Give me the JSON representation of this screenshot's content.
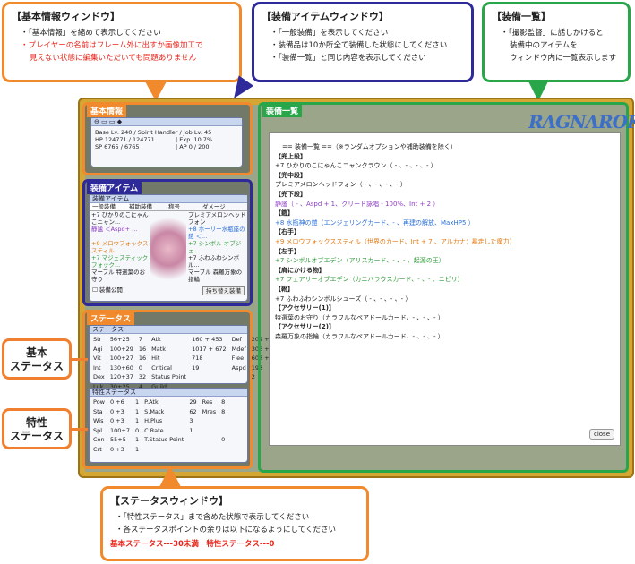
{
  "callouts": {
    "basic": {
      "title": "【基本情報ウィンドウ】",
      "lines": [
        "・「基本情報」を縮めて表示してください",
        "・プレイヤーの名前はフレーム外に出すか画像加工で",
        "見えない状態に編集いただいても問題ありません"
      ]
    },
    "equip": {
      "title": "【装備アイテムウィンドウ】",
      "lines": [
        "・「一般装備」を表示してください",
        "・装備品は10か所全て装備した状態にしてください",
        "・「装備一覧」と同じ内容を表示してください"
      ]
    },
    "list": {
      "title": "【装備一覧】",
      "lines": [
        "・「撮影監督」に話しかけると",
        "装備中のアイテムを",
        "ウィンドウ内に一覧表示します"
      ]
    },
    "status": {
      "title": "【ステータスウィンドウ】",
      "lines": [
        "・「特性ステータス」まで含めた状態で表示してください",
        "・各ステータスポイントの余りは以下になるようにしてください"
      ],
      "note": "基本ステータス---30未満　特性ステータス---0"
    }
  },
  "side_labels": {
    "basic_status": [
      "基本",
      "ステータス"
    ],
    "trait_status": [
      "特性",
      "ステータス"
    ]
  },
  "panels": {
    "basic": "基本情報",
    "equip": "装備アイテム",
    "status": "ステータス",
    "list": "装備一覧"
  },
  "basic_info": {
    "line1": "Base Lv. 240 / Spirit Handler / Job Lv. 45",
    "hp": "HP 124771 / 124771",
    "exp": "| Exp. 10.7%",
    "sp": "SP 6765 / 6765",
    "ap": "| AP 0 / 200"
  },
  "equip_win": {
    "title": "装備アイテム",
    "tabs": [
      "一般装備",
      "補助装備",
      "称号",
      "ダメージ"
    ],
    "left": [
      "+7 ひかりのこにゃんこニャン...",
      "静謐 ＜Aspd+ ...",
      "+9 メロウフォックススティル",
      "+7 マジェスティックフォック...",
      "マーブル 特選葉のお守り"
    ],
    "right": [
      "プレミアメロンヘッドフォン",
      "+8 ホーリー水瓶座の鎧 ＜...",
      "+7 シンボル オブジェ...",
      "+7 ふわふわシンボル...",
      "マーブル 森羅万象の指輪"
    ],
    "public": "装備公開",
    "swap": "持ち替え装備"
  },
  "status_win": {
    "title": "ステータス",
    "rows": [
      [
        "Str",
        "56+25",
        "7",
        "Atk",
        "160 + 453",
        "Def",
        "209 + 223"
      ],
      [
        "Agi",
        "100+29",
        "16",
        "Matk",
        "1017 + 672",
        "Mdef",
        "306 + 50"
      ],
      [
        "Vit",
        "100+27",
        "16",
        "Hit",
        "718",
        "Flee",
        "608 + 7"
      ],
      [
        "Int",
        "130+60",
        "0",
        "Critical",
        "19",
        "Aspd",
        "193"
      ],
      [
        "Dex",
        "120+37",
        "32",
        "Status Point",
        "",
        "",
        "2"
      ],
      [
        "Luk",
        "30+25",
        "4",
        "Guild",
        "",
        "",
        ""
      ]
    ],
    "trait_title": "特性ステータス",
    "trait_rows": [
      [
        "Pow",
        "0 +6",
        "1",
        "P.Atk",
        "29",
        "Res",
        "8"
      ],
      [
        "Sta",
        "0 +3",
        "1",
        "S.Matk",
        "62",
        "Mres",
        "8"
      ],
      [
        "Wis",
        "0 +3",
        "1",
        "H.Plus",
        "3",
        "",
        ""
      ],
      [
        "Spl",
        "100+7",
        "0",
        "C.Rate",
        "1",
        "",
        ""
      ],
      [
        "Con",
        "55+5",
        "1",
        "T.Status Point",
        "",
        "",
        "0"
      ],
      [
        "Crt",
        "0 +3",
        "1",
        "",
        "",
        "",
        ""
      ]
    ]
  },
  "equip_list": {
    "header": "== 装備一覧 ==（※ランダムオプションや補助装備を除く）",
    "lines": [
      {
        "t": "【兜上段】",
        "c": "hd"
      },
      {
        "t": "+7 ひかりのこにゃんこニャンクラウン（ - 、- 、- 、- ）",
        "c": ""
      },
      {
        "t": "【兜中段】",
        "c": "hd"
      },
      {
        "t": "プレミアメロンヘッドフォン（ - 、- 、- 、- ）",
        "c": ""
      },
      {
        "t": "【兜下段】",
        "c": "hd"
      },
      {
        "t": "静謐（ - 、Aspd + 1、クリード詠唱 - 100%、Int + 2 ）",
        "c": "c-purple"
      },
      {
        "t": "【鎧】",
        "c": "hd"
      },
      {
        "t": "+8 水瓶神の鎧（エンジェリングカード、- 、再建の解放、MaxHP5 ）",
        "c": "c-blue"
      },
      {
        "t": "【右手】",
        "c": "hd"
      },
      {
        "t": "+9 メロウフォックススティル（世界のカード、Int + 7 、アルカナ：暴走した魔力）",
        "c": "c-orange"
      },
      {
        "t": "【左手】",
        "c": "hd"
      },
      {
        "t": "+7 シンボルオブエデン（アリスカード、- 、- 、起源の王）",
        "c": "c-green"
      },
      {
        "t": "【肩にかける物】",
        "c": "hd"
      },
      {
        "t": "+7 フェアリーオブエデン（カニバラウスカード、- 、- 、ニビリ）",
        "c": "c-green"
      },
      {
        "t": "【靴】",
        "c": "hd"
      },
      {
        "t": "+7 ふわふわシンボルシューズ（ - 、- 、- 、- ）",
        "c": ""
      },
      {
        "t": "【アクセサリー(1)】",
        "c": "hd"
      },
      {
        "t": "特選葉のお守り（カラフルなペアドールカード、- 、- 、- ）",
        "c": ""
      },
      {
        "t": "【アクセサリー(2)】",
        "c": "hd"
      },
      {
        "t": "森羅万象の指輪（カラフルなペアドールカード、- 、- 、- ）",
        "c": ""
      }
    ],
    "close": "close"
  },
  "logo": "RAGNAROK",
  "colors": {
    "orange": "#f08a2c",
    "blue": "#2e2a9a",
    "green": "#2aa64a"
  }
}
